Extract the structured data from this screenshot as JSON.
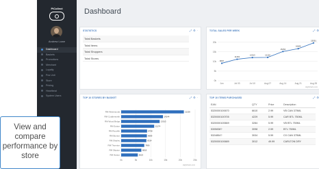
{
  "app": {
    "brand": "PiCollect",
    "user_name": "Andrew Lowe"
  },
  "nav": [
    {
      "label": "Dashboard",
      "active": true
    },
    {
      "label": "Baskets",
      "active": false
    },
    {
      "label": "Promotions",
      "active": false
    },
    {
      "label": "Merchant",
      "active": false
    },
    {
      "label": "Loyalty",
      "active": false
    },
    {
      "label": "Pos Unit",
      "active": false
    },
    {
      "label": "Store",
      "active": false
    },
    {
      "label": "Pricing",
      "active": false
    },
    {
      "label": "Heartbeat",
      "active": false
    },
    {
      "label": "System Users",
      "active": false
    }
  ],
  "page": {
    "title": "Dashboard"
  },
  "statistics": {
    "title": "STATISTICS",
    "items": [
      "Total Baskets",
      "Total Items",
      "Total Shoppers",
      "Total Stores"
    ]
  },
  "icons": {
    "expand": "expand-icon",
    "settings": "gear-icon",
    "close": "close-icon"
  },
  "colors": {
    "accent": "#4a7fc0",
    "sidebar": "#23282f",
    "bar": "#2f6fbd"
  },
  "sales_chart": {
    "title": "TOTAL SALES PER WEEK",
    "chart_data": {
      "type": "line",
      "x": [
        "Jun",
        "Jul 03",
        "Jul 10",
        "Aug 07",
        "Aug 14",
        "Aug 21",
        "Aug 28"
      ],
      "series": [
        {
          "values": [
            9067,
            11163,
            12013,
            12102,
            15154,
            16646,
            19591
          ]
        }
      ],
      "point_labels": [
        "9067",
        "11163",
        "12013",
        "12102",
        "15154",
        "16646",
        "19591"
      ],
      "y_ticks": [
        "20k",
        "15k",
        "10k",
        "5k",
        "0k"
      ],
      "ylim": [
        0,
        22000
      ],
      "grid": true,
      "footer": "Highcharts.com"
    }
  },
  "stores_chart": {
    "title": "TOP 10 STORES BY BASKET",
    "chart_data": {
      "type": "bar",
      "orientation": "horizontal",
      "categories": [
        "RM Westmunds",
        "RM Coddersmith",
        "RM Wood Brdgs",
        "RM Sutton",
        "RM Rooville",
        "RM Bunton",
        "RM Shipley",
        "RM Thornton",
        "RM Skipton",
        "RM Harton"
      ],
      "values": [
        21200,
        14144,
        13013,
        11174,
        8758,
        8689,
        8514,
        7806,
        6818,
        5623
      ],
      "value_labels": [
        "21200",
        "14144",
        "13013",
        "11174",
        "8758",
        "8689",
        "8514",
        "7806",
        "6818",
        "5623"
      ],
      "x_ticks": [
        "0k",
        "5k",
        "10k",
        "15k",
        "20k",
        "25k"
      ],
      "xlim": [
        0,
        25000
      ],
      "grid": true,
      "footer": "Highcharts.com"
    }
  },
  "items_table": {
    "title": "TOP 10 ITEMS PURCHASED",
    "columns": [
      "EAN",
      "QTY",
      "Price",
      "Description"
    ],
    "rows": [
      [
        "5320000100670",
        "6610",
        "2.99",
        "VB CAN 375ML"
      ],
      [
        "5320000100705",
        "4229",
        "5.99",
        "CAR BTL 750ML"
      ],
      [
        "5320000100669",
        "3284",
        "5.99",
        "VB BTL 750ML"
      ],
      [
        "5305838?",
        "3098",
        "2.59",
        "BTL 750ML"
      ],
      [
        "5324854?",
        "3034",
        "5.59",
        "CX CAN 375ML"
      ],
      [
        "5320000100689",
        "3012",
        "49.99",
        "CARLTON DRY"
      ]
    ]
  },
  "callout": {
    "text": "View and compare performance by store"
  }
}
